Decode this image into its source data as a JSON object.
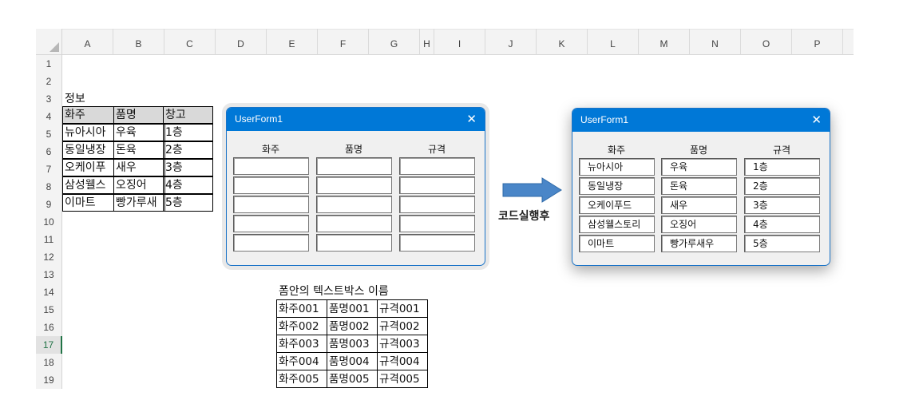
{
  "sheet": {
    "columns": [
      "A",
      "B",
      "C",
      "D",
      "E",
      "F",
      "G",
      "H",
      "I",
      "J",
      "K",
      "L",
      "M",
      "N",
      "O",
      "P"
    ],
    "rows": [
      "1",
      "2",
      "3",
      "4",
      "5",
      "6",
      "7",
      "8",
      "9",
      "10",
      "11",
      "12",
      "13",
      "14",
      "15",
      "16",
      "17",
      "18",
      "19"
    ],
    "active_row": "17"
  },
  "info_table": {
    "title": "정보",
    "headers": [
      "화주",
      "품명",
      "창고"
    ],
    "rows": [
      [
        "뉴아시아",
        "우육",
        "1층"
      ],
      [
        "동일냉장",
        "돈육",
        "2층"
      ],
      [
        "오케이푸",
        "새우",
        "3층"
      ],
      [
        "삼성웰스",
        "오징어",
        "4층"
      ],
      [
        "이마트",
        "빵가루새",
        "5층"
      ]
    ]
  },
  "names_table": {
    "title": "폼안의 텍스트박스 이름",
    "rows": [
      [
        "화주001",
        "품명001",
        "규격001"
      ],
      [
        "화주002",
        "품명002",
        "규격002"
      ],
      [
        "화주003",
        "품명003",
        "규격003"
      ],
      [
        "화주004",
        "품명004",
        "규격004"
      ],
      [
        "화주005",
        "품명005",
        "규격005"
      ]
    ]
  },
  "form_before": {
    "title": "UserForm1",
    "close": "✕",
    "labels": [
      "화주",
      "품명",
      "규격"
    ],
    "values": [
      [
        "",
        "",
        ""
      ],
      [
        "",
        "",
        ""
      ],
      [
        "",
        "",
        ""
      ],
      [
        "",
        "",
        ""
      ],
      [
        "",
        "",
        ""
      ]
    ]
  },
  "form_after": {
    "title": "UserForm1",
    "close": "✕",
    "labels": [
      "화주",
      "품명",
      "규격"
    ],
    "values": [
      [
        "뉴아시아",
        "우육",
        "1층"
      ],
      [
        "동일냉장",
        "돈육",
        "2층"
      ],
      [
        "오케이푸드",
        "새우",
        "3층"
      ],
      [
        "삼성웰스토리",
        "오징어",
        "4층"
      ],
      [
        "이마트",
        "빵가루새우",
        "5층"
      ]
    ]
  },
  "run_label": "코드실행후",
  "colors": {
    "titlebar": "#0078d7",
    "arrow": "#4a86c8",
    "header_fill": "#d9d9d9"
  }
}
